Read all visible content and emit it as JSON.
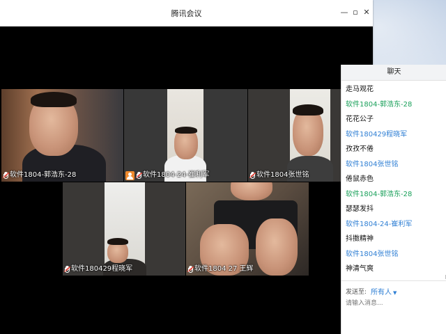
{
  "window": {
    "title": "腾讯会议",
    "minimize_glyph": "—",
    "maximize_glyph": "▫",
    "close_glyph": "✕"
  },
  "participants": [
    {
      "name": "软件1804-郭浩东-28",
      "muted": true
    },
    {
      "name": "软件1804-24-崔利军",
      "muted": true,
      "host": true
    },
    {
      "name": "软件1804张世铭",
      "muted": true
    },
    {
      "name": "软件180429程晓军",
      "muted": true
    },
    {
      "name": "软件1804 27 王辉",
      "muted": true
    }
  ],
  "chat": {
    "title": "聊天",
    "messages": [
      {
        "type": "msg",
        "text": "走马观花"
      },
      {
        "type": "sender",
        "text": "软件1804-郭浩东-28",
        "color": "#1aa05a"
      },
      {
        "type": "msg",
        "text": "花花公子"
      },
      {
        "type": "sender",
        "text": "软件180429程晓军",
        "color": "#2f7fd4"
      },
      {
        "type": "msg",
        "text": "孜孜不倦"
      },
      {
        "type": "sender",
        "text": "软件1804张世铭",
        "color": "#2f7fd4"
      },
      {
        "type": "msg",
        "text": "倦鼠赤色"
      },
      {
        "type": "sender",
        "text": "软件1804-郭浩东-28",
        "color": "#1aa05a"
      },
      {
        "type": "msg",
        "text": "瑟瑟发抖"
      },
      {
        "type": "sender",
        "text": "软件1804-24-崔利军",
        "color": "#2f7fd4"
      },
      {
        "type": "msg",
        "text": "抖擞精神"
      },
      {
        "type": "sender",
        "text": "软件1804张世铭",
        "color": "#2f7fd4"
      },
      {
        "type": "msg",
        "text": "神清气爽"
      }
    ],
    "send_to_label": "发送至:",
    "send_to_value": "所有人",
    "input_placeholder": "请输入消息..."
  },
  "colors": {
    "accent_blue": "#2f7fd4",
    "accent_green": "#1aa05a",
    "host_orange": "#f08a2c",
    "muted_red": "#e0453a"
  }
}
